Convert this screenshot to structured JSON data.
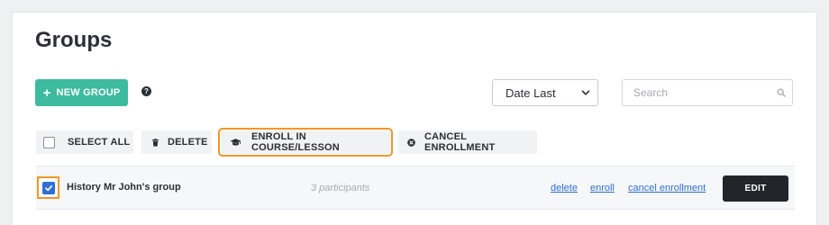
{
  "page": {
    "title": "Groups"
  },
  "toolbar": {
    "new_group_label": "NEW GROUP",
    "help_glyph": "?",
    "sort_selected": "Date Last",
    "search_placeholder": "Search"
  },
  "bulk_actions": {
    "select_all": "SELECT ALL",
    "delete": "DELETE",
    "enroll": "ENROLL IN COURSE/LESSON",
    "cancel_enrollment": "CANCEL ENROLLMENT"
  },
  "groups": [
    {
      "name": "History Mr John's group",
      "participants": "3 participants",
      "checked": true,
      "links": {
        "delete": "delete",
        "enroll": "enroll",
        "cancel": "cancel enrollment"
      },
      "edit_label": "EDIT"
    }
  ],
  "colors": {
    "accent_green": "#3dbb9e",
    "highlight_orange": "#f2962a",
    "link_blue": "#2f6fd6",
    "dark_button": "#22262b"
  },
  "icons": {
    "new_group": "plus-icon",
    "help": "question-circle-icon",
    "sort": "chevron-down-icon",
    "search": "search-icon",
    "delete": "trash-icon",
    "enroll": "graduation-cap-icon",
    "cancel": "x-circle-icon",
    "row_check": "checkmark-icon"
  }
}
